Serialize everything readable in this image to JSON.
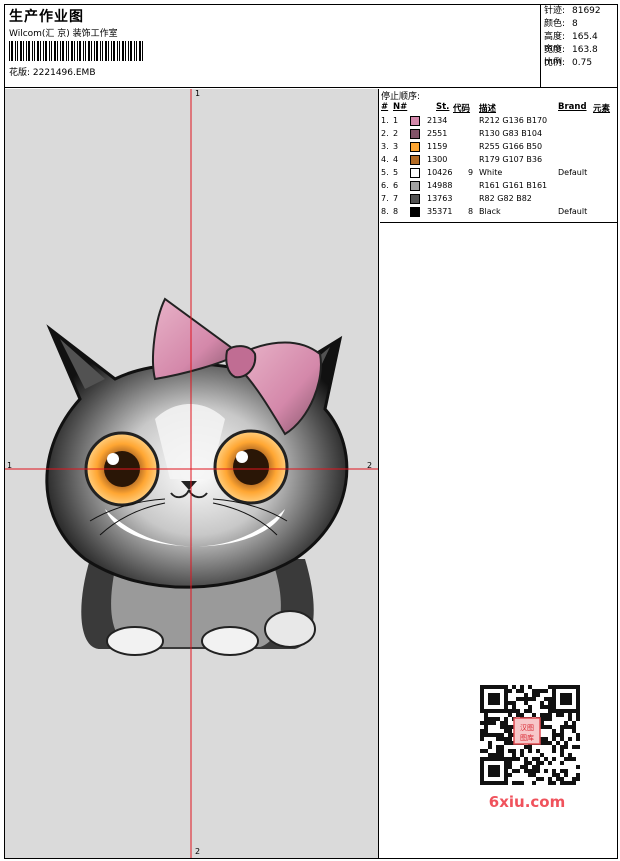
{
  "header": {
    "title": "生产作业图",
    "company": "Wilcom(汇 京) 装饰工作室",
    "design_label": "花版:",
    "design_file": "2221496.EMB"
  },
  "stats": [
    {
      "label": "针迹:",
      "value": "81692"
    },
    {
      "label": "颜色:",
      "value": "8"
    },
    {
      "label": "高度:",
      "value": "165.4 mm"
    },
    {
      "label": "宽度:",
      "value": "163.8 mm"
    },
    {
      "label": "比例:",
      "value": "0.75"
    }
  ],
  "canvas": {
    "axis_top": "1",
    "axis_bottom": "2",
    "axis_left": "1",
    "axis_right": "2"
  },
  "colors": {
    "canvas_bg": "#dadada",
    "axis": "#e0141e"
  },
  "sequence": {
    "title": "停止顺序:",
    "headers": [
      "#",
      "N#",
      "St.",
      "代码",
      "描述",
      "Brand",
      "元素"
    ],
    "rows": [
      {
        "num": "1.",
        "n": "1",
        "color": "#D488AA",
        "st": "2134",
        "code": "",
        "desc": "R212 G136 B170",
        "brand": ""
      },
      {
        "num": "2.",
        "n": "2",
        "color": "#825368",
        "st": "2551",
        "code": "",
        "desc": "R130 G83 B104",
        "brand": ""
      },
      {
        "num": "3.",
        "n": "3",
        "color": "#FFA632",
        "st": "1159",
        "code": "",
        "desc": "R255 G166 B50",
        "brand": ""
      },
      {
        "num": "4.",
        "n": "4",
        "color": "#B36B24",
        "st": "1300",
        "code": "",
        "desc": "R179 G107 B36",
        "brand": ""
      },
      {
        "num": "5.",
        "n": "5",
        "color": "#FFFFFF",
        "st": "10426",
        "code": "9",
        "desc": "White",
        "brand": "Default"
      },
      {
        "num": "6.",
        "n": "6",
        "color": "#A1A1A1",
        "st": "14988",
        "code": "",
        "desc": "R161 G161 B161",
        "brand": ""
      },
      {
        "num": "7.",
        "n": "7",
        "color": "#525252",
        "st": "13763",
        "code": "",
        "desc": "R82 G82 B82",
        "brand": ""
      },
      {
        "num": "8.",
        "n": "8",
        "color": "#000000",
        "st": "35371",
        "code": "8",
        "desc": "Black",
        "brand": "Default"
      }
    ]
  },
  "watermark": {
    "seal_text": "汉图图库",
    "site": "6xiu.com"
  }
}
